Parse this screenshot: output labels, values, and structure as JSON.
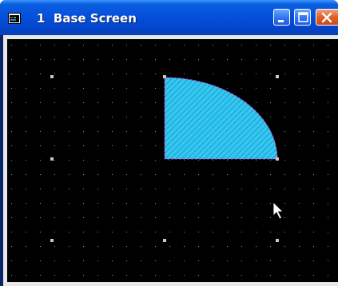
{
  "window": {
    "number": "1",
    "title": "Base Screen",
    "controls": {
      "minimize": "minimize-icon",
      "maximize": "maximize-icon",
      "close": "close-icon"
    }
  },
  "canvas": {
    "background": "#000000",
    "grid_dot_color": "#2ec8a0",
    "handle_color": "#c8c8c8",
    "shape": {
      "type": "quarter-circle",
      "fill": "#33c8f0",
      "hatch": "#1a90c8",
      "outline": "#c040c8"
    },
    "cursor": "arrow-pointer-icon"
  }
}
